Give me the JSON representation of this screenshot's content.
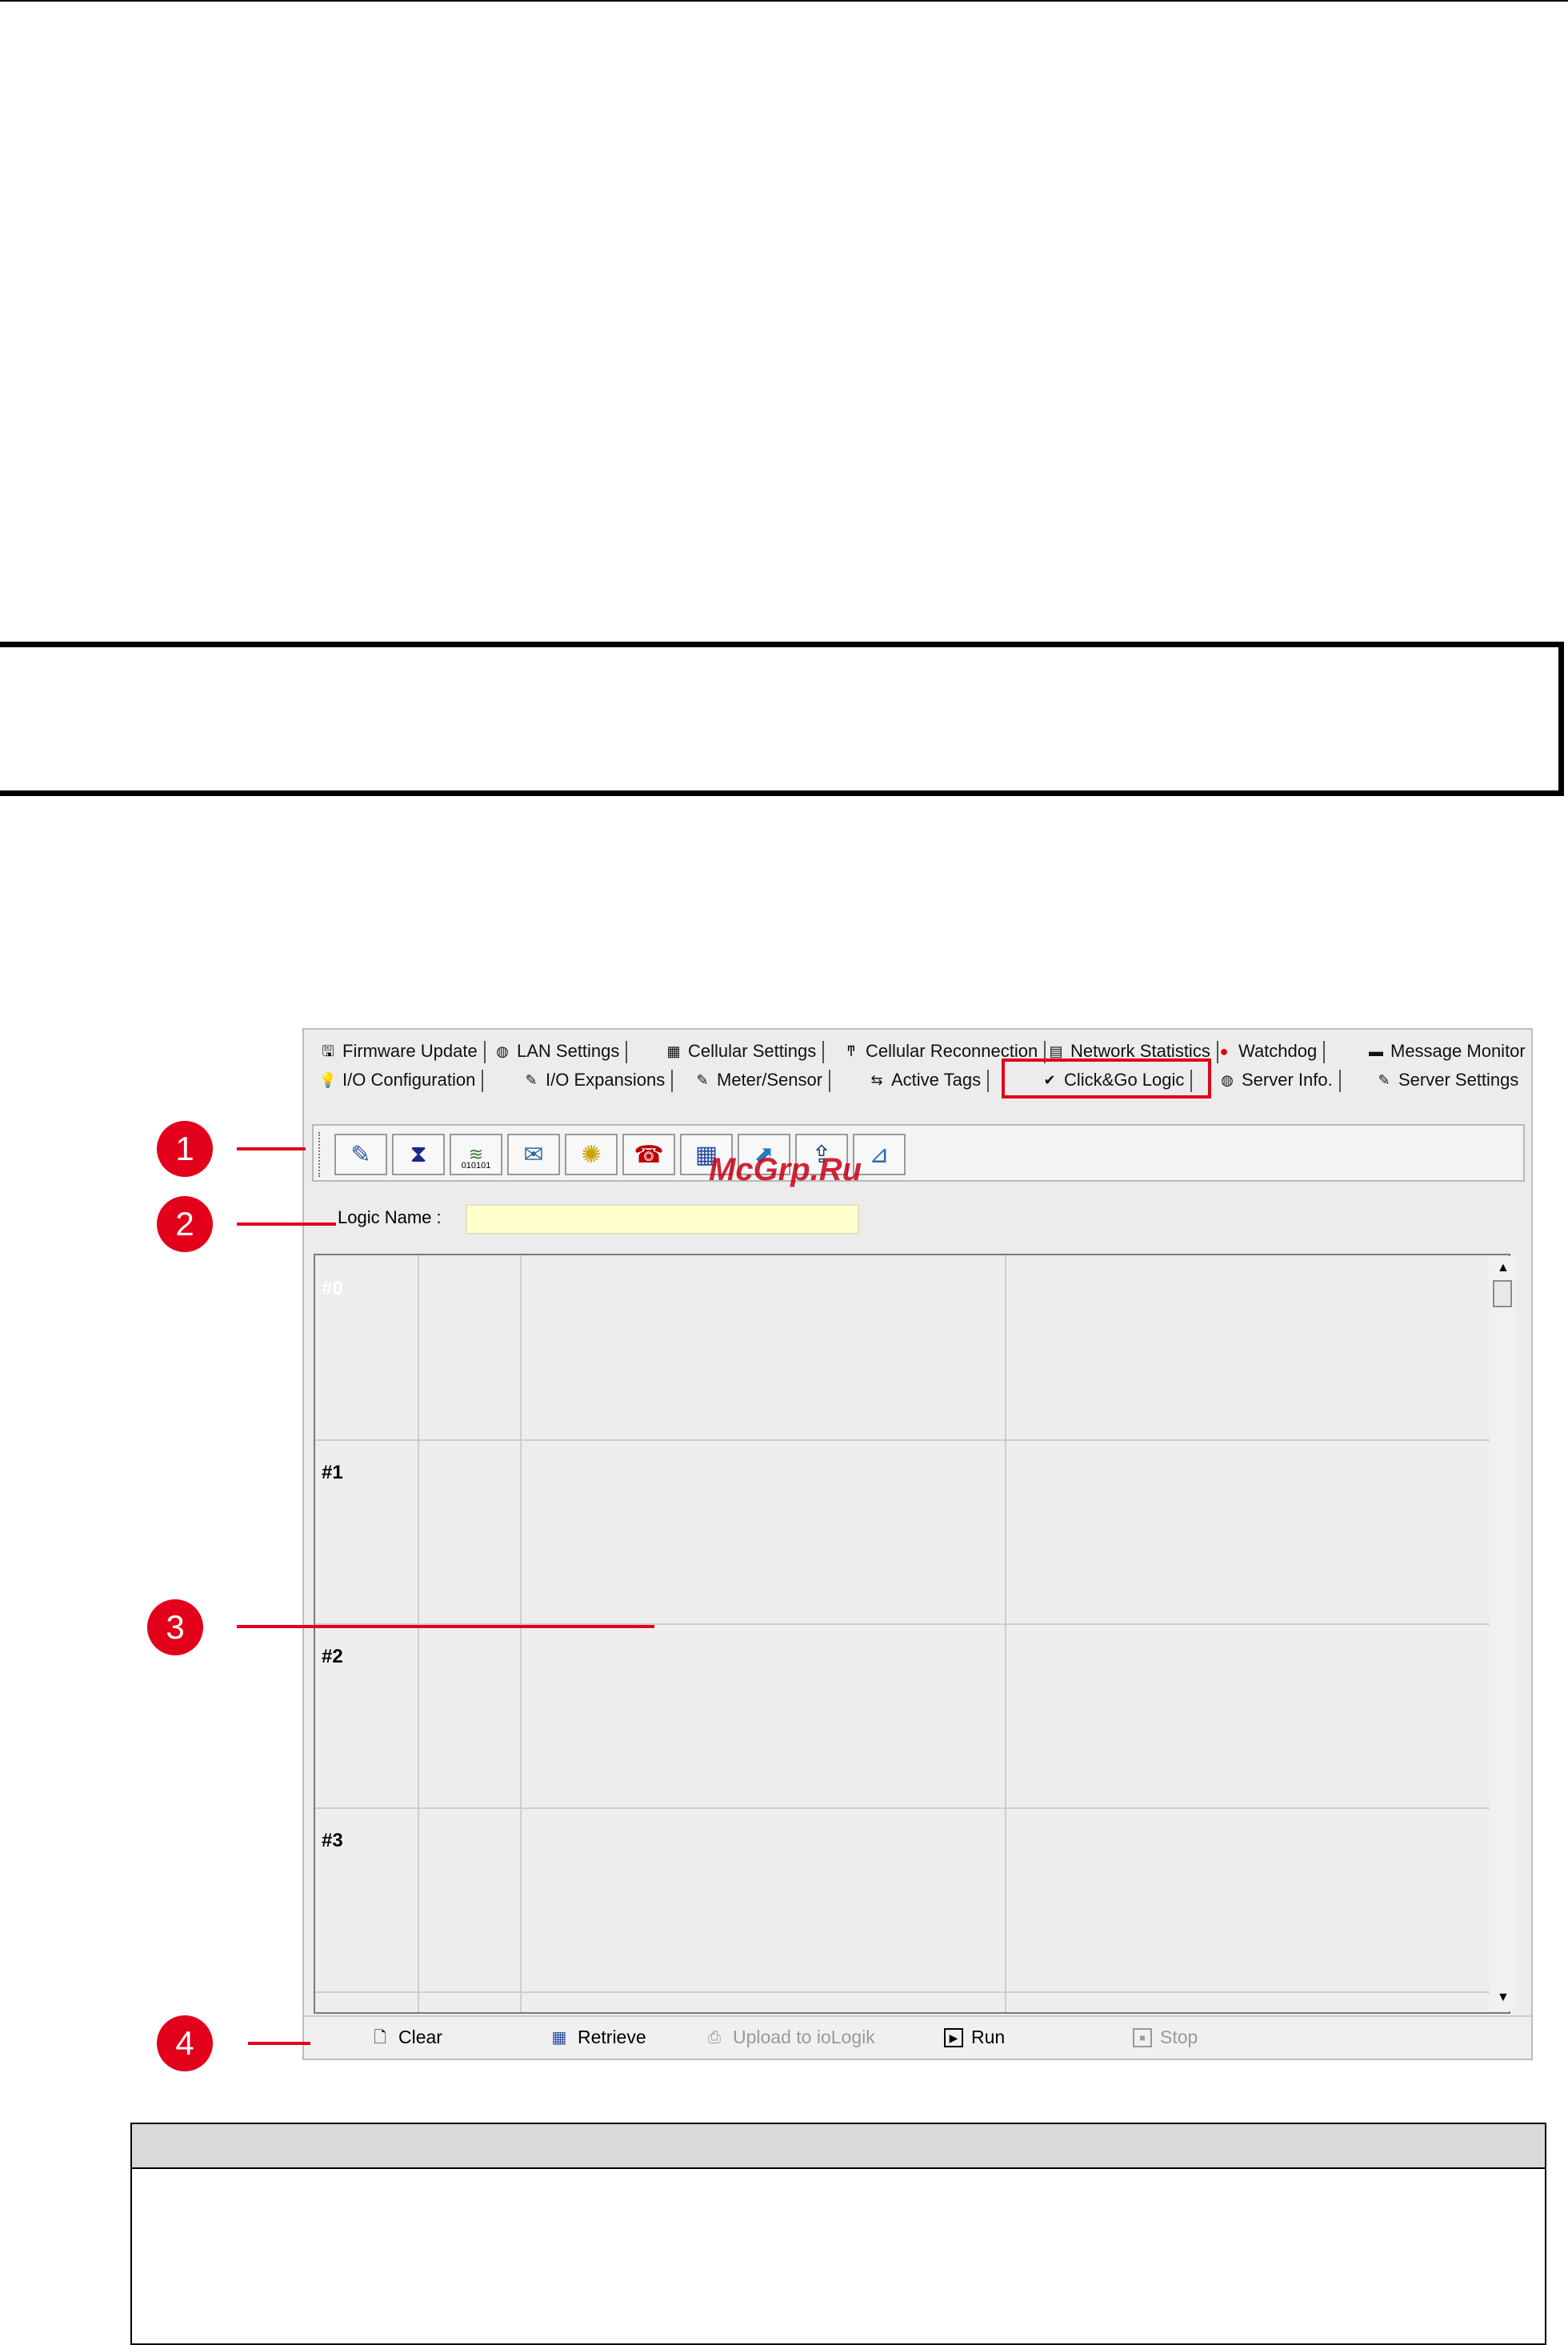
{
  "tabs": {
    "row1": [
      "Firmware Update",
      "LAN Settings",
      "Cellular Settings",
      "Cellular Reconnection",
      "Network Statistics",
      "Watchdog",
      "Message Monitor"
    ],
    "row2": [
      "I/O Configuration",
      "I/O Expansions",
      "Meter/Sensor",
      "Active Tags",
      "Click&Go Logic",
      "Server Info.",
      "Server Settings"
    ],
    "selected": "Click&Go Logic"
  },
  "toolbar": {
    "icons": [
      "edit-icon",
      "hourglass-icon",
      "binary-signal-icon",
      "email-icon",
      "sms-icon",
      "phone-icon",
      "calendar-icon",
      "snmp-trap-icon",
      "upload-icon",
      "tag-edit-icon"
    ],
    "binary_label": "010101"
  },
  "logic": {
    "name_label": "Logic Name :",
    "name_value": ""
  },
  "grid": {
    "rows": [
      "#0",
      "#1",
      "#2",
      "#3"
    ]
  },
  "bottom": {
    "clear": "Clear",
    "retrieve": "Retrieve",
    "upload": "Upload to ioLogik",
    "run": "Run",
    "stop": "Stop"
  },
  "callouts": [
    "1",
    "2",
    "3",
    "4"
  ],
  "watermark": "McGrp.Ru",
  "colors": {
    "callout": "#e3001a",
    "highlight": "#e0001a",
    "input_bg": "#ffffcc"
  }
}
